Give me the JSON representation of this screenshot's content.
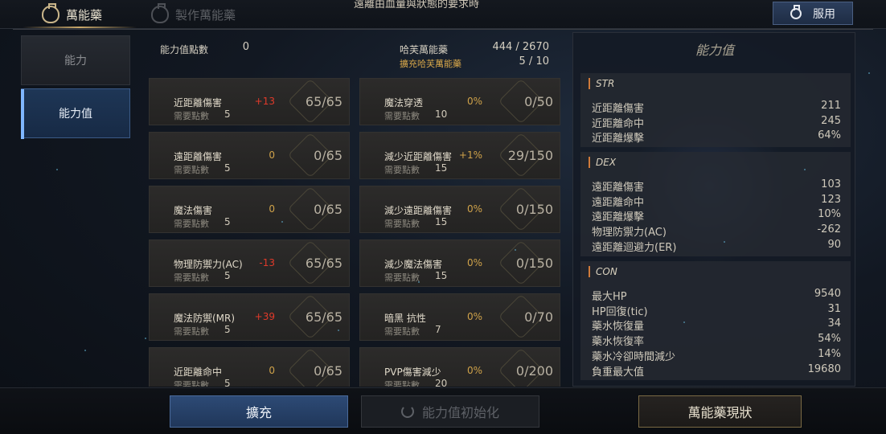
{
  "top": {
    "message": "遠離由血量與狀態的要求時",
    "tabs": [
      {
        "label": "萬能藥",
        "icon": "potion-icon"
      },
      {
        "label": "製作萬能藥",
        "icon": "potion-craft-icon"
      }
    ],
    "use_button": "服用"
  },
  "nav": {
    "items": [
      {
        "label": "能力"
      },
      {
        "label": "能力值"
      }
    ]
  },
  "header": {
    "points_label": "能力值點數",
    "points_value": "0",
    "elixir_label": "哈芙萬能藥",
    "elixir_value": "444 / 2670",
    "expand_label": "擴充哈芙萬能藥",
    "expand_value": "5 / 10"
  },
  "cards": [
    {
      "name": "近距離傷害",
      "req_label": "需要點數",
      "req": "5",
      "bonus": "+13",
      "ratio": "65/65"
    },
    {
      "name": "魔法穿透",
      "req_label": "需要點數",
      "req": "10",
      "bonus": "0%",
      "ratio": "0/50"
    },
    {
      "name": "遠距離傷害",
      "req_label": "需要點數",
      "req": "5",
      "bonus": "0",
      "ratio": "0/65"
    },
    {
      "name": "減少近距離傷害",
      "req_label": "需要點數",
      "req": "15",
      "bonus": "+1%",
      "ratio": "29/150"
    },
    {
      "name": "魔法傷害",
      "req_label": "需要點數",
      "req": "5",
      "bonus": "0",
      "ratio": "0/65"
    },
    {
      "name": "減少遠距離傷害",
      "req_label": "需要點數",
      "req": "15",
      "bonus": "0%",
      "ratio": "0/150"
    },
    {
      "name": "物理防禦力(AC)",
      "req_label": "需要點數",
      "req": "5",
      "bonus": "-13",
      "ratio": "65/65"
    },
    {
      "name": "減少魔法傷害",
      "req_label": "需要點數",
      "req": "15",
      "bonus": "0%",
      "ratio": "0/150"
    },
    {
      "name": "魔法防禦(MR)",
      "req_label": "需要點數",
      "req": "5",
      "bonus": "+39",
      "ratio": "65/65"
    },
    {
      "name": "暗黑 抗性",
      "req_label": "需要點數",
      "req": "7",
      "bonus": "0%",
      "ratio": "0/70"
    },
    {
      "name": "近距離命中",
      "req_label": "需要點數",
      "req": "5",
      "bonus": "0",
      "ratio": "0/65"
    },
    {
      "name": "PVP傷害減少",
      "req_label": "需要點數",
      "req": "20",
      "bonus": "0%",
      "ratio": "0/200"
    }
  ],
  "stats": {
    "title": "能力值",
    "sections": [
      {
        "name": "STR",
        "rows": [
          {
            "label": "近距離傷害",
            "value": "211"
          },
          {
            "label": "近距離命中",
            "value": "245"
          },
          {
            "label": "近距離爆擊",
            "value": "64%"
          }
        ]
      },
      {
        "name": "DEX",
        "rows": [
          {
            "label": "遠距離傷害",
            "value": "103"
          },
          {
            "label": "遠距離命中",
            "value": "123"
          },
          {
            "label": "遠距離爆擊",
            "value": "10%"
          },
          {
            "label": "物理防禦力(AC)",
            "value": "-262"
          },
          {
            "label": "遠距離迴避力(ER)",
            "value": "90"
          }
        ]
      },
      {
        "name": "CON",
        "rows": [
          {
            "label": "最大HP",
            "value": "9540"
          },
          {
            "label": "HP回復(tic)",
            "value": "31"
          },
          {
            "label": "藥水恢復量",
            "value": "34"
          },
          {
            "label": "藥水恢復率",
            "value": "54%"
          },
          {
            "label": "藥水冷卻時間減少",
            "value": "14%"
          },
          {
            "label": "負重最大值",
            "value": "19680"
          }
        ]
      }
    ]
  },
  "bottom": {
    "expand": "擴充",
    "reset": "能力值初始化",
    "status": "萬能藥現狀"
  },
  "colors": {
    "accent_gold": "#d7a74a",
    "bonus_red": "#e03a2a",
    "primary_blue": "#2d4a75"
  }
}
